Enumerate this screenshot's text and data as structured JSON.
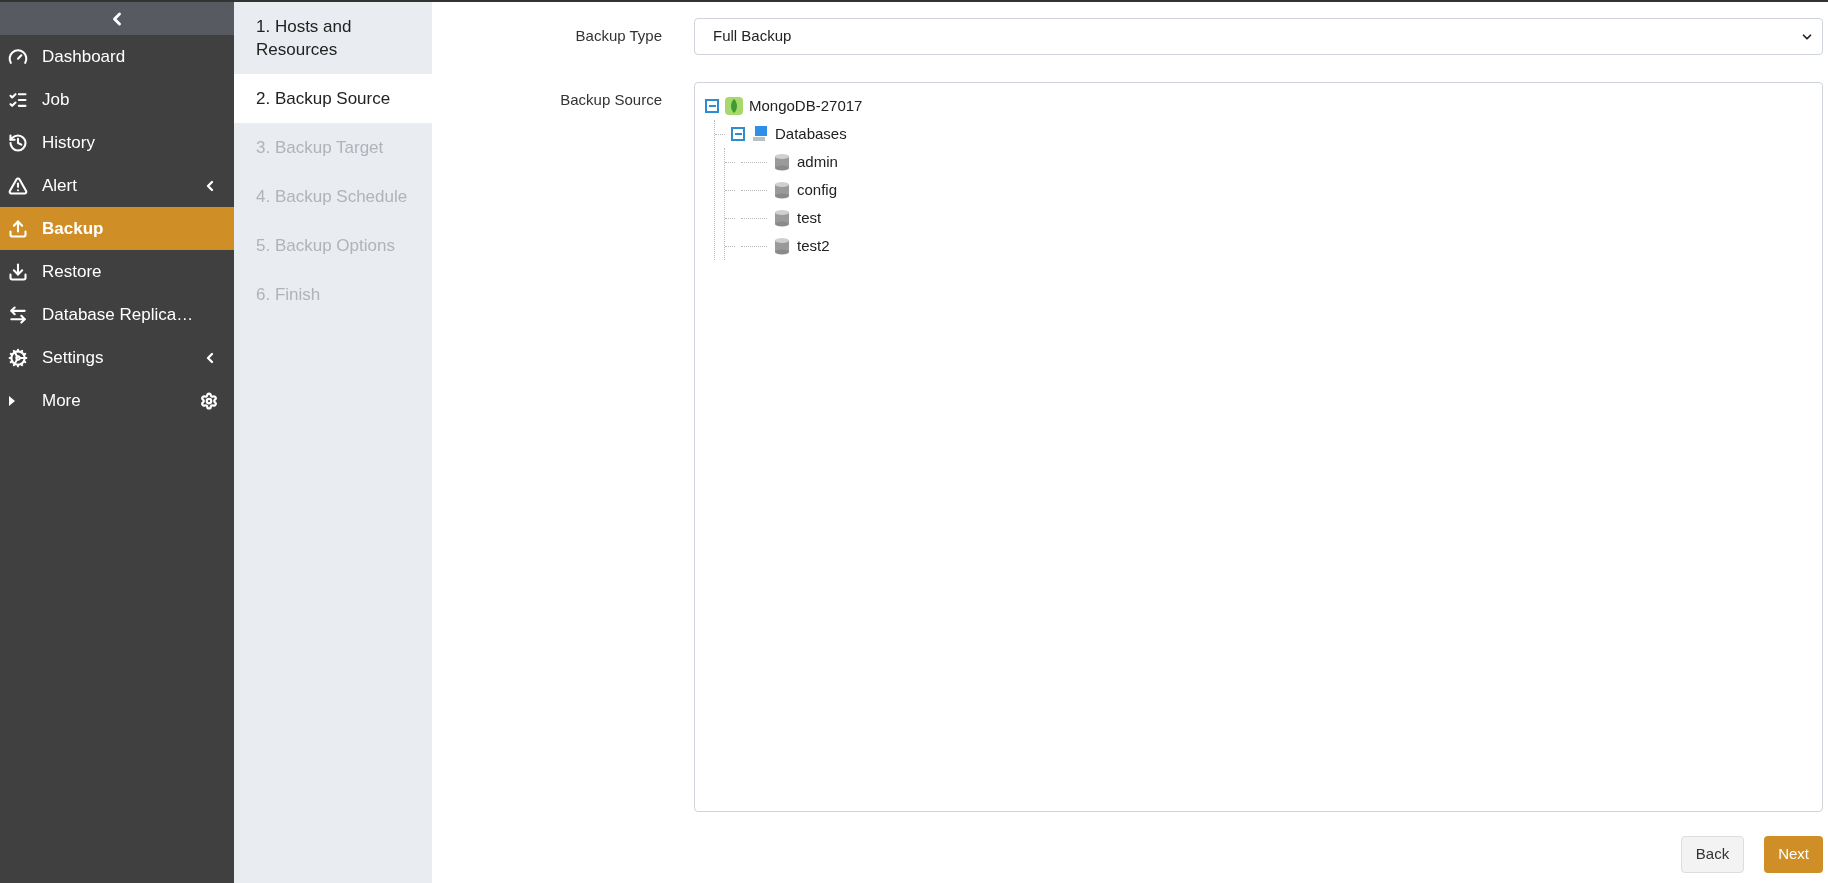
{
  "sidebar": {
    "items": [
      {
        "label": "Dashboard",
        "selected": false
      },
      {
        "label": "Job",
        "selected": false
      },
      {
        "label": "History",
        "selected": false
      },
      {
        "label": "Alert",
        "selected": false,
        "expandable": true
      },
      {
        "label": "Backup",
        "selected": true
      },
      {
        "label": "Restore",
        "selected": false
      },
      {
        "label": "Database Replica…",
        "selected": false
      },
      {
        "label": "Settings",
        "selected": false,
        "expandable": true
      },
      {
        "label": "More",
        "selected": false,
        "gear": true
      }
    ]
  },
  "steps": [
    {
      "label": "1. Hosts and Resources",
      "selected": false,
      "disabled": false
    },
    {
      "label": "2. Backup Source",
      "selected": true,
      "disabled": false
    },
    {
      "label": "3. Backup Target",
      "selected": false,
      "disabled": true
    },
    {
      "label": "4. Backup Schedule",
      "selected": false,
      "disabled": true
    },
    {
      "label": "5. Backup Options",
      "selected": false,
      "disabled": true
    },
    {
      "label": "6. Finish",
      "selected": false,
      "disabled": true
    }
  ],
  "form": {
    "backup_type": {
      "label": "Backup Type",
      "value": "Full Backup"
    },
    "backup_source": {
      "label": "Backup Source",
      "tree": [
        {
          "label": "MongoDB-27017",
          "kind": "server",
          "expanded": true,
          "children": [
            {
              "label": "Databases",
              "kind": "folder",
              "expanded": true,
              "children": [
                {
                  "label": "admin",
                  "kind": "database"
                },
                {
                  "label": "config",
                  "kind": "database"
                },
                {
                  "label": "test",
                  "kind": "database"
                },
                {
                  "label": "test2",
                  "kind": "database"
                }
              ]
            }
          ]
        }
      ]
    }
  },
  "buttons": [
    {
      "label": "Back",
      "kind": "secondary"
    },
    {
      "label": "Next",
      "kind": "primary"
    }
  ]
}
